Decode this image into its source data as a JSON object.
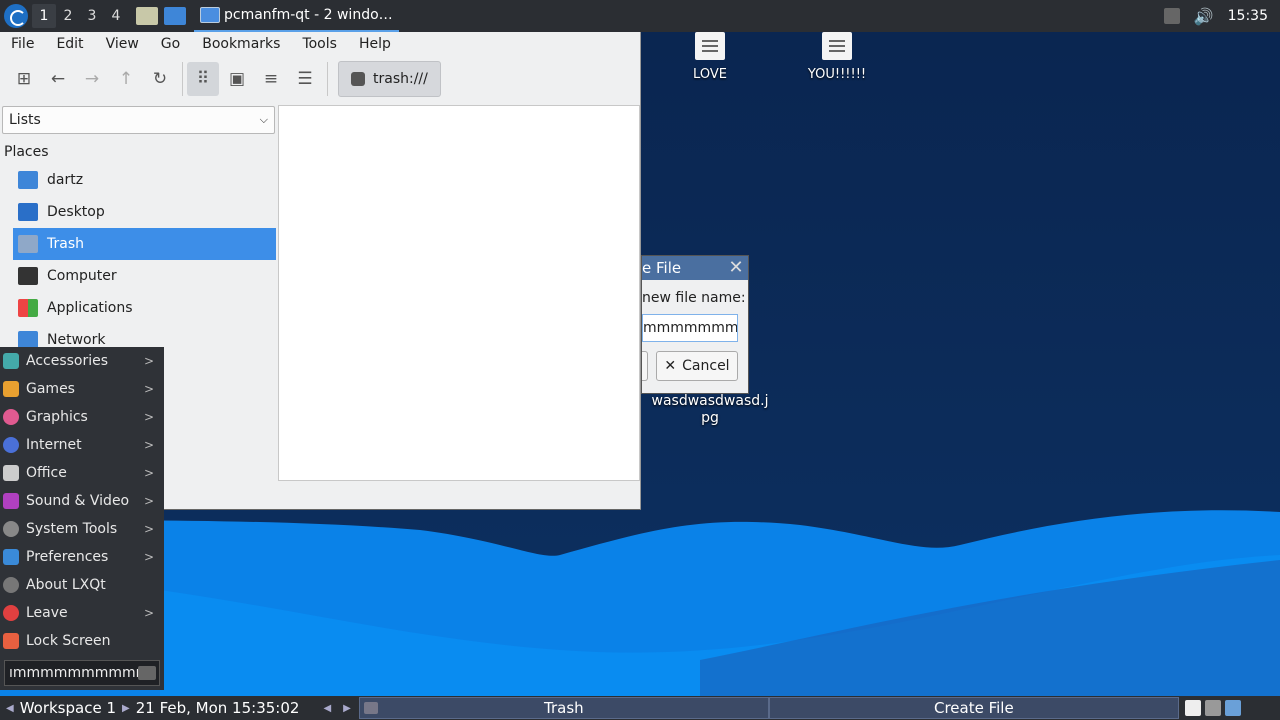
{
  "top_panel": {
    "workspaces": [
      "1",
      "2",
      "3",
      "4"
    ],
    "task_title": "pcmanfm-qt - 2 windo…",
    "clock": "15:35"
  },
  "desktop": {
    "icons": [
      "LOVE",
      "YOU!!!!!!"
    ],
    "file_label_1": "wasdwasdwasd.j",
    "file_label_2": "pg"
  },
  "file_manager": {
    "menu": [
      "File",
      "Edit",
      "View",
      "Go",
      "Bookmarks",
      "Tools",
      "Help"
    ],
    "path": "trash:///",
    "side_mode": "Lists",
    "places_header": "Places",
    "places": [
      "dartz",
      "Desktop",
      "Trash",
      "Computer",
      "Applications",
      "Network"
    ]
  },
  "dialog": {
    "title": "e File",
    "prompt": "new file name:",
    "entry_value": "mmmmmmmm",
    "cancel_label": "Cancel"
  },
  "app_menu": {
    "items": [
      "Accessories",
      "Games",
      "Graphics",
      "Internet",
      "Office",
      "Sound & Video",
      "System Tools",
      "Preferences",
      "About LXQt",
      "Leave",
      "Lock Screen"
    ],
    "search_value": "ımmmmmmmmmm"
  },
  "bottom_panel": {
    "workspace_label": "Workspace 1",
    "datetime": "21 Feb, Mon 15:35:02",
    "tasks": [
      "Trash",
      "Create File"
    ]
  },
  "colors": {
    "selection": "#3d8ee8",
    "panel": "#2b2e33",
    "menu_bg": "#2f3237"
  }
}
